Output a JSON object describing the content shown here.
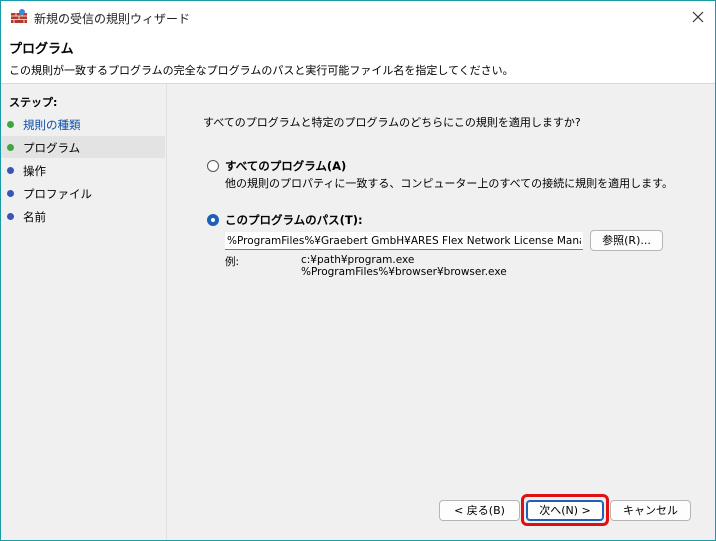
{
  "window": {
    "title": "新規の受信の規則ウィザード",
    "close_label": "✕"
  },
  "header": {
    "title": "プログラム",
    "description": "この規則が一致するプログラムの完全なプログラムのパスと実行可能ファイル名を指定してください。"
  },
  "sidebar": {
    "steps_label": "ステップ:",
    "items": [
      {
        "label": "規則の種類",
        "dot_color": "#3fa63f"
      },
      {
        "label": "プログラム",
        "dot_color": "#3fa63f"
      },
      {
        "label": "操作",
        "dot_color": "#3a55b8"
      },
      {
        "label": "プロファイル",
        "dot_color": "#3a55b8"
      },
      {
        "label": "名前",
        "dot_color": "#3a55b8"
      }
    ]
  },
  "main": {
    "question": "すべてのプログラムと特定のプログラムのどちらにこの規則を適用しますか?",
    "option_all": {
      "label": "すべてのプログラム(A)",
      "description": "他の規則のプロパティに一致する、コンピューター上のすべての接続に規則を適用します。",
      "selected": false
    },
    "option_path": {
      "label": "このプログラムのパス(T):",
      "selected": true,
      "value": "%ProgramFiles%¥Graebert GmbH¥ARES Flex Network License Manage",
      "browse_label": "参照(R)..."
    },
    "example": {
      "label": "例:",
      "lines": [
        "c:¥path¥program.exe",
        "%ProgramFiles%¥browser¥browser.exe"
      ]
    }
  },
  "footer": {
    "back_label": "< 戻る(B)",
    "next_label": "次へ(N) >",
    "cancel_label": "キャンセル"
  },
  "colors": {
    "accent": "#1e5fb8",
    "highlight": "#e01010",
    "window_border": "#1a9aa8"
  }
}
